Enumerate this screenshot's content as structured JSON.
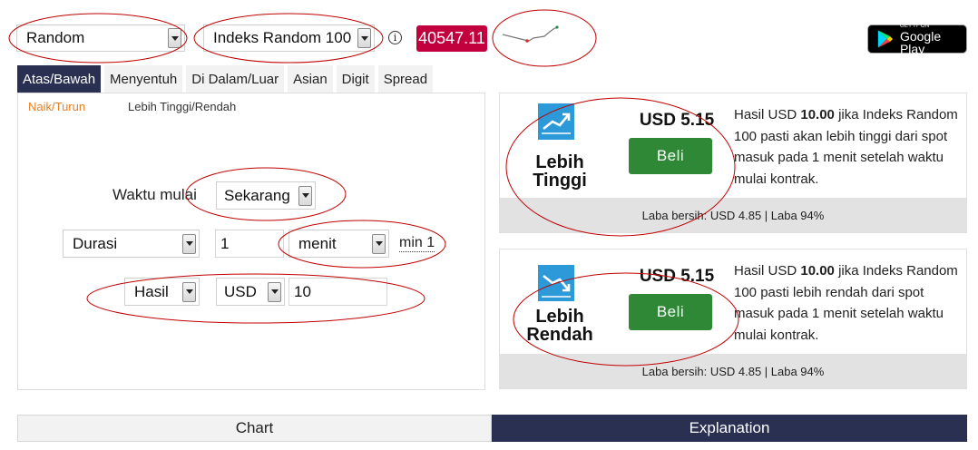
{
  "header": {
    "market_select": "Random",
    "underlying_select": "Indeks Random 100",
    "spot_price": "40547.11",
    "info_icon": "info-icon",
    "google_play": {
      "small": "GET IT ON",
      "big": "Google Play"
    }
  },
  "tabs": [
    {
      "label": "Atas/Bawah",
      "active": true
    },
    {
      "label": "Menyentuh"
    },
    {
      "label": "Di Dalam/Luar"
    },
    {
      "label": "Asian"
    },
    {
      "label": "Digit"
    },
    {
      "label": "Spread"
    }
  ],
  "subtabs": [
    {
      "label": "Naik/Turun",
      "color": "#e98024"
    },
    {
      "label": "Lebih Tinggi/Rendah"
    }
  ],
  "form": {
    "start_label": "Waktu mulai",
    "start_value": "Sekarang",
    "duration_type": "Durasi",
    "duration_value": "1",
    "duration_unit": "menit",
    "duration_min": "min 1",
    "payout_type": "Hasil",
    "currency": "USD",
    "amount": "10"
  },
  "contracts": [
    {
      "title_line1": "Lebih",
      "title_line2": "Tinggi",
      "price": "USD 5.15",
      "buy_label": "Beli",
      "desc_prefix": "Hasil USD ",
      "desc_amount": "10.00",
      "desc_suffix": " jika Indeks Random 100 pasti akan lebih tinggi dari spot masuk pada 1 menit setelah waktu mulai kontrak.",
      "footer": "Laba bersih: USD 4.85 | Laba 94%",
      "icon": "arrow-up-icon"
    },
    {
      "title_line1": "Lebih",
      "title_line2": "Rendah",
      "price": "USD 5.15",
      "buy_label": "Beli",
      "desc_prefix": "Hasil USD ",
      "desc_amount": "10.00",
      "desc_suffix": " jika Indeks Random 100 pasti lebih rendah dari spot masuk pada 1 menit setelah waktu mulai kontrak.",
      "footer": "Laba bersih: USD 4.85 | Laba 94%",
      "icon": "arrow-down-icon"
    }
  ],
  "bottom_tabs": [
    {
      "label": "Chart",
      "active": false
    },
    {
      "label": "Explanation",
      "active": true
    }
  ],
  "colors": {
    "spot_bg": "#c2003e",
    "tab_active_bg": "#2a3052",
    "buy_button": "#2e8836",
    "contract_icon": "#2c9ad9",
    "annotation_oval": "#c00000"
  }
}
